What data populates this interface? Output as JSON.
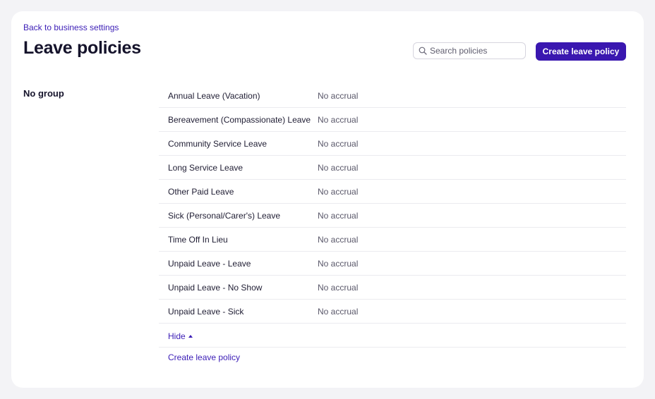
{
  "nav": {
    "back_label": "Back to business settings"
  },
  "header": {
    "title": "Leave policies",
    "search_placeholder": "Search policies",
    "search_value": "",
    "create_button_label": "Create leave policy"
  },
  "group": {
    "name": "No group",
    "policies": [
      {
        "name": "Annual Leave (Vacation)",
        "accrual": "No accrual"
      },
      {
        "name": "Bereavement (Compassionate) Leave",
        "accrual": "No accrual"
      },
      {
        "name": "Community Service Leave",
        "accrual": "No accrual"
      },
      {
        "name": "Long Service Leave",
        "accrual": "No accrual"
      },
      {
        "name": "Other Paid Leave",
        "accrual": "No accrual"
      },
      {
        "name": "Sick (Personal/Carer's) Leave",
        "accrual": "No accrual"
      },
      {
        "name": "Time Off In Lieu",
        "accrual": "No accrual"
      },
      {
        "name": "Unpaid Leave - Leave",
        "accrual": "No accrual"
      },
      {
        "name": "Unpaid Leave - No Show",
        "accrual": "No accrual"
      },
      {
        "name": "Unpaid Leave - Sick",
        "accrual": "No accrual"
      }
    ],
    "hide_label": "Hide",
    "create_link_label": "Create leave policy"
  },
  "icons": {
    "search": "search-icon",
    "hide": "caret-up-icon"
  },
  "colors": {
    "accent": "#3a17b0",
    "link": "#3b1db6",
    "background": "#f3f3f6"
  }
}
